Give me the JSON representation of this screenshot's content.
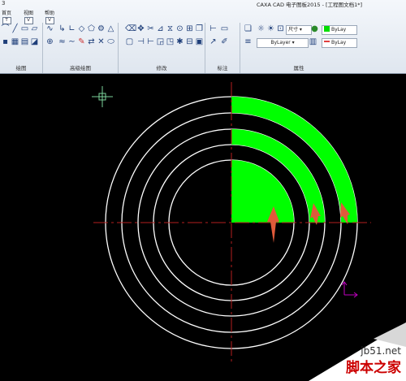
{
  "window": {
    "title": "CAXA CAD 电子图板2015 - [工程图文档1*]",
    "quick_mark": "3"
  },
  "tabs": [
    {
      "label": "首页",
      "key": "T"
    },
    {
      "label": "视图",
      "key": "V"
    },
    {
      "label": "帮助",
      "key": "V"
    }
  ],
  "groups": {
    "draw": "绘图",
    "advanced_draw": "高级绘图",
    "modify": "修改",
    "annotate": "标注",
    "properties": "属性"
  },
  "properties": {
    "dim_label": "尺寸",
    "layer_color": "ByLay",
    "linetype": "ByLayer",
    "lineweight": "ByLay",
    "layer_color_value": "#00dd00",
    "lineweight_color_value": "#e04040"
  },
  "drawing": {
    "background": "#000000",
    "circle_color": "#ffffff",
    "fill_color": "#00ff00",
    "arrow_color": "#e05a3a",
    "axis_color": "#b41e1e",
    "ucs_color": "#c000c0"
  },
  "watermark": {
    "site": "jb51.net",
    "name": "脚本之家"
  }
}
